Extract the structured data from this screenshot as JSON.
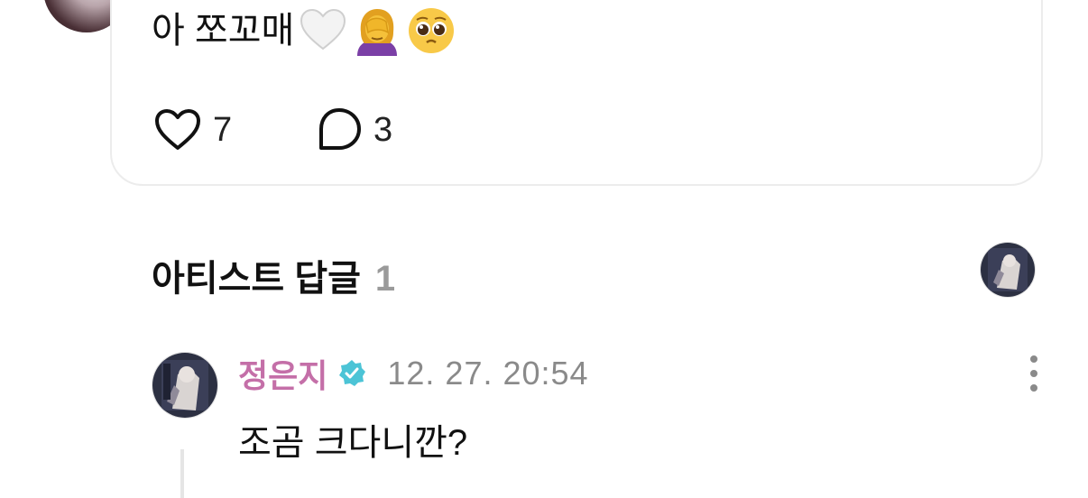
{
  "post": {
    "text": "아 쪼꼬매",
    "emojis": [
      "white-heart",
      "woman-facepalming",
      "pleading-face"
    ],
    "likes": "7",
    "comments": "3"
  },
  "artist_replies": {
    "title": "아티스트 답글",
    "count": "1"
  },
  "comment": {
    "author": "정은지",
    "timestamp": "12. 27. 20:54",
    "text": "조곰 크다니깐?",
    "verified": true
  },
  "colors": {
    "author": "#c46fa8",
    "verified_badge": "#4cc4d6",
    "muted": "#8a8a8a"
  }
}
